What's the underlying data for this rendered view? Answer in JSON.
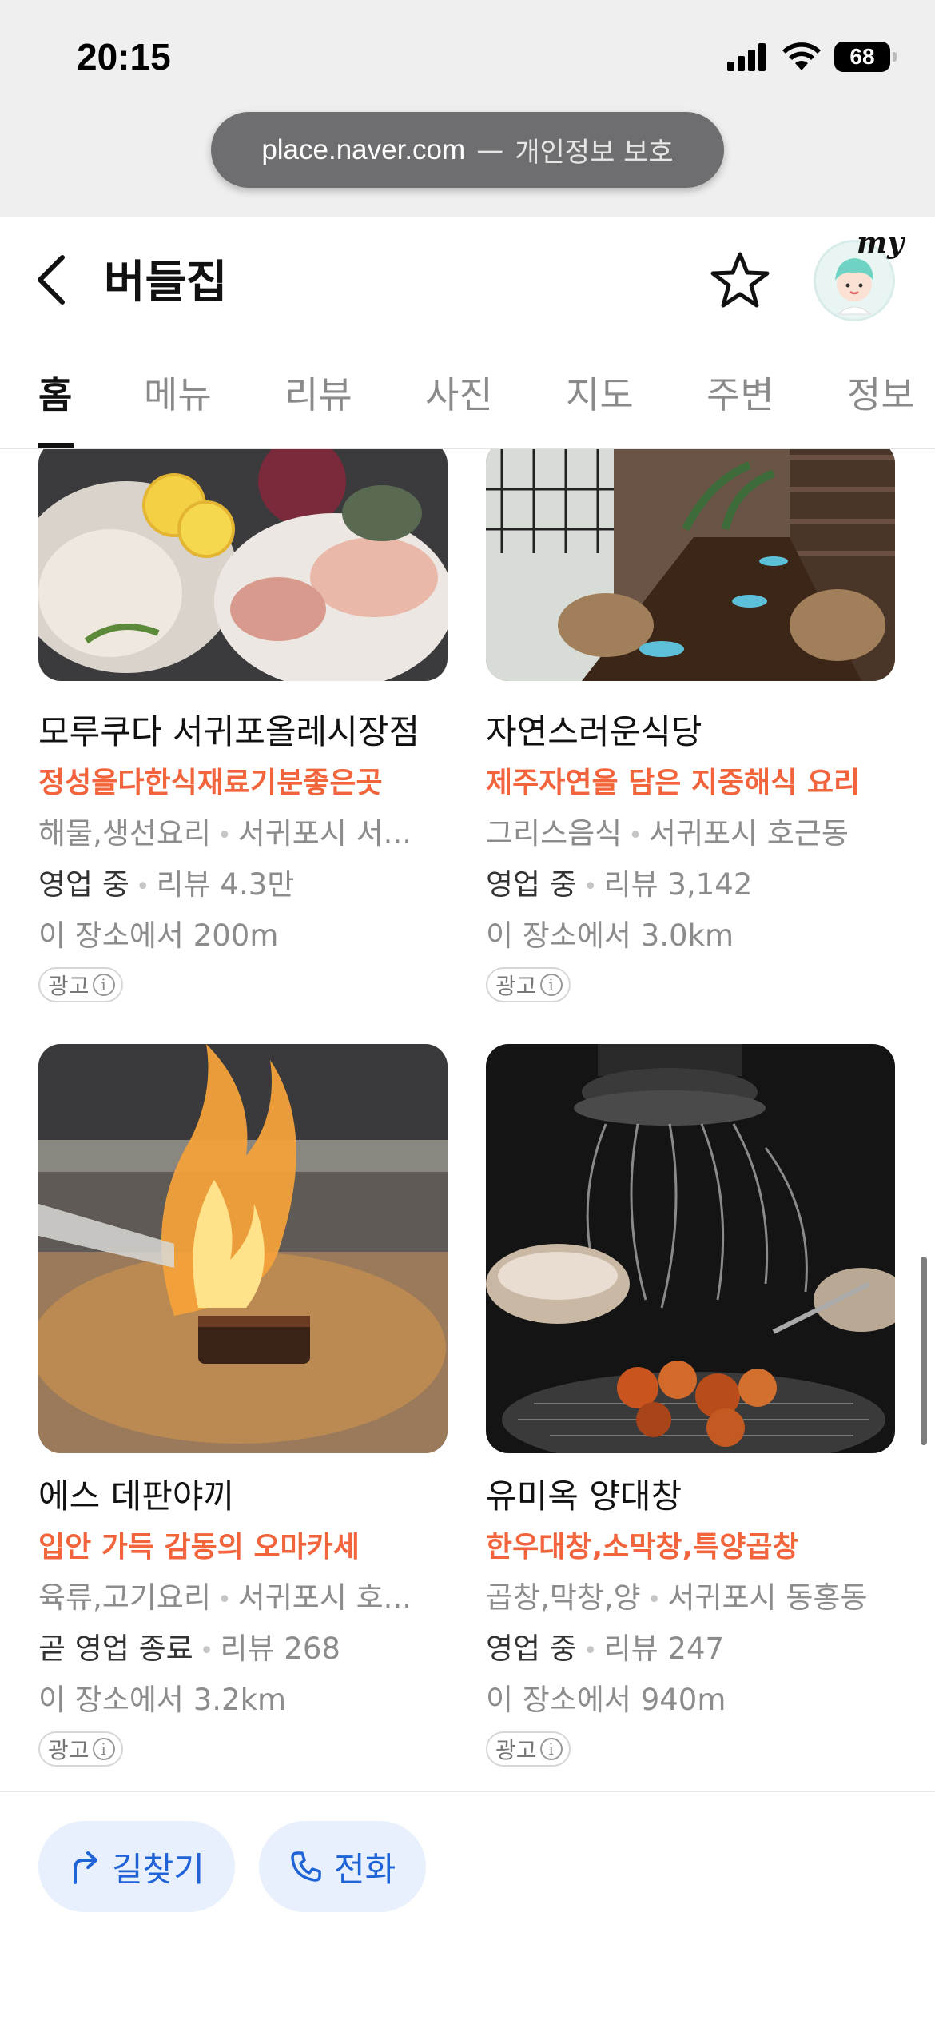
{
  "status_bar": {
    "time": "20:15",
    "battery": "68",
    "url_host": "place.naver.com",
    "url_separator": "—",
    "url_note": "개인정보 보호"
  },
  "header": {
    "title": "버들집",
    "back_icon": "chevron-left-icon",
    "favorite_icon": "star-outline-icon",
    "avatar_badge": "my"
  },
  "tabs": [
    {
      "label": "홈",
      "active": true
    },
    {
      "label": "메뉴",
      "active": false
    },
    {
      "label": "리뷰",
      "active": false
    },
    {
      "label": "사진",
      "active": false
    },
    {
      "label": "지도",
      "active": false
    },
    {
      "label": "주변",
      "active": false
    },
    {
      "label": "정보",
      "active": false
    }
  ],
  "cards": [
    {
      "name": "모루쿠다 서귀포올레시장점",
      "promo": "정성을다한식재료기분좋은곳",
      "category": "해물,생선요리",
      "location": "서귀포시 서...",
      "status": "영업 중",
      "reviews": "리뷰 4.3만",
      "distance": "이 장소에서 200m",
      "ad_label": "광고",
      "ad_info": "i"
    },
    {
      "name": "자연스러운식당",
      "promo": "제주자연을 담은 지중해식 요리",
      "category": "그리스음식",
      "location": "서귀포시 호근동",
      "status": "영업 중",
      "reviews": "리뷰 3,142",
      "distance": "이 장소에서 3.0km",
      "ad_label": "광고",
      "ad_info": "i"
    },
    {
      "name": "에스 데판야끼",
      "promo": "입안 가득 감동의 오마카세",
      "category": "육류,고기요리",
      "location": "서귀포시 호...",
      "status": "곧 영업 종료",
      "reviews": "리뷰 268",
      "distance": "이 장소에서 3.2km",
      "ad_label": "광고",
      "ad_info": "i"
    },
    {
      "name": "유미옥 양대창",
      "promo": "한우대창,소막창,특양곱창",
      "category": "곱창,막창,양",
      "location": "서귀포시 동홍동",
      "status": "영업 중",
      "reviews": "리뷰 247",
      "distance": "이 장소에서 940m",
      "ad_label": "광고",
      "ad_info": "i"
    }
  ],
  "bottom_bar": {
    "directions_label": "길찾기",
    "directions_icon": "turn-arrow-icon",
    "call_label": "전화",
    "call_icon": "phone-icon"
  },
  "colors": {
    "promo": "#f2643c",
    "action_text": "#1f63d6",
    "action_bg": "#e7f0fc"
  }
}
